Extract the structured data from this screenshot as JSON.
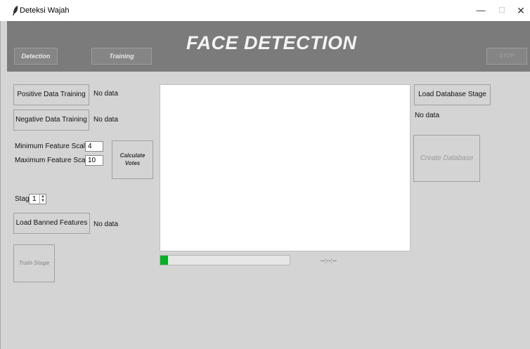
{
  "window": {
    "title": "Deteksi Wajah",
    "controls": {
      "minimize": "—",
      "maximize": "☐",
      "close": "✕"
    }
  },
  "header": {
    "heading": "FACE DETECTION",
    "tabs": {
      "detection": "Detection",
      "training": "Training"
    },
    "stop_label": "STOP"
  },
  "training": {
    "positive_button": "Positive Data Training",
    "positive_status": "No data",
    "negative_button": "Negative Data Training",
    "negative_status": "No data",
    "min_scale_label": "Minimum Feature Scale",
    "min_scale_value": "4",
    "max_scale_label": "Maximum Feature Scale",
    "max_scale_value": "10",
    "calculate_button_line1": "Calculate",
    "calculate_button_line2": "Votes",
    "stage_label": "Stage :",
    "stage_value": "1",
    "banned_button": "Load Banned Features",
    "banned_status": "No data",
    "train_stage_button": "Train Stage"
  },
  "progress": {
    "fraction": 0.06,
    "fill_color": "#06b025",
    "timer": "--:--:--"
  },
  "database": {
    "load_stage_button": "Load Database Stage",
    "status": "No data",
    "create_button": "Create Database"
  }
}
